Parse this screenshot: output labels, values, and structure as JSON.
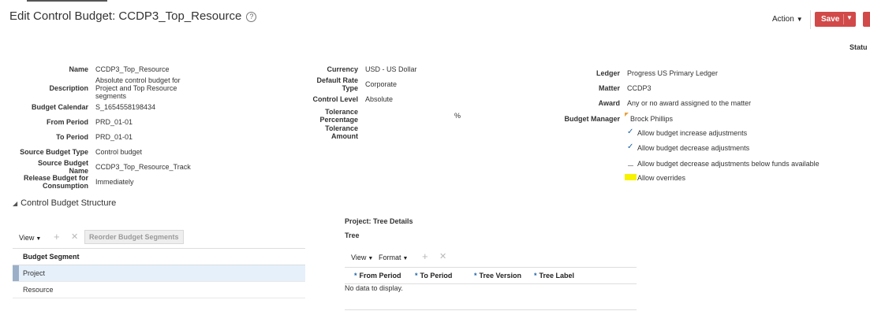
{
  "page": {
    "title": "Edit Control Budget: CCDP3_Top_Resource",
    "help_icon": "?",
    "action_label": "Action",
    "save_label": "Save",
    "status_label": "Statu"
  },
  "form_left": {
    "name_label": "Name",
    "name_value": "CCDP3_Top_Resource",
    "description_label": "Description",
    "description_value": "Absolute control budget for Project and Top Resource segments",
    "calendar_label": "Budget Calendar",
    "calendar_value": "S_1654558198434",
    "from_period_label": "From Period",
    "from_period_value": "PRD_01-01",
    "to_period_label": "To Period",
    "to_period_value": "PRD_01-01",
    "source_type_label": "Source Budget Type",
    "source_type_value": "Control budget",
    "source_name_label": "Source Budget Name",
    "source_name_value": "CCDP3_Top_Resource_Track",
    "release_label": "Release Budget for Consumption",
    "release_value": "Immediately"
  },
  "form_mid": {
    "currency_label": "Currency",
    "currency_value": "USD - US Dollar",
    "rate_type_label": "Default Rate Type",
    "rate_type_value": "Corporate",
    "control_level_label": "Control Level",
    "control_level_value": "Absolute",
    "tolerance_pct_label": "Tolerance Percentage",
    "tolerance_pct_unit": "%",
    "tolerance_amt_label": "Tolerance Amount"
  },
  "form_right": {
    "ledger_label": "Ledger",
    "ledger_value": "Progress US Primary Ledger",
    "matter_label": "Matter",
    "matter_value": "CCDP3",
    "award_label": "Award",
    "award_value": "Any or no award assigned to the matter",
    "manager_label": "Budget Manager",
    "manager_value": "Brock Phillips",
    "options": [
      {
        "label": "Allow budget increase adjustments",
        "checked": true
      },
      {
        "label": "Allow budget decrease adjustments",
        "checked": true
      },
      {
        "label": "Allow budget decrease adjustments below funds available",
        "checked": false
      },
      {
        "label": "Allow overrides",
        "checked": false
      }
    ]
  },
  "structure": {
    "section_title": "Control Budget Structure",
    "view_label": "View",
    "add_icon": "+",
    "remove_icon": "✕",
    "reorder_label": "Reorder Budget Segments",
    "column_header": "Budget Segment",
    "rows": [
      "Project",
      "Resource"
    ]
  },
  "tree": {
    "title": "Project: Tree Details",
    "subtitle": "Tree",
    "view_label": "View",
    "format_label": "Format",
    "columns": [
      "From Period",
      "To Period",
      "Tree Version",
      "Tree Label"
    ],
    "required_mark": "*",
    "empty_text": "No data to display."
  },
  "colors": {
    "save_button": "#d14949",
    "selected_row": "#e5f0fb",
    "highlight": "#f6f200",
    "check": "#1a62a8"
  }
}
